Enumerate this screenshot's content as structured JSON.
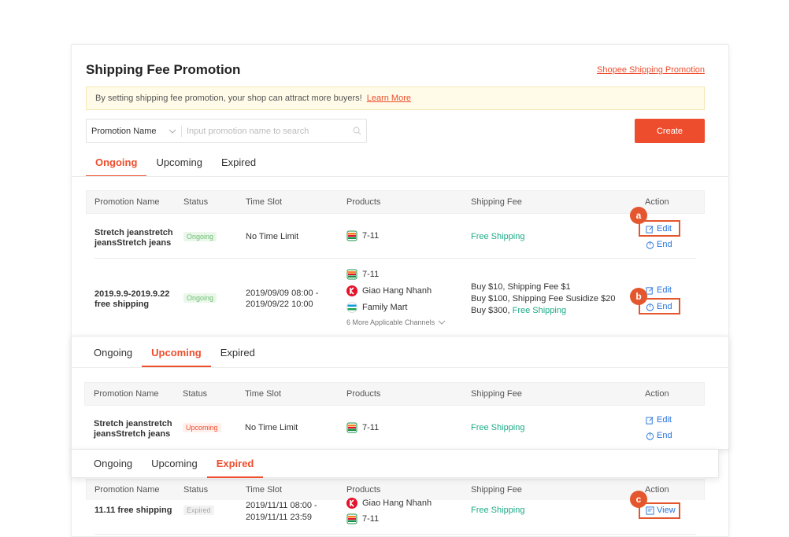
{
  "header": {
    "title": "Shipping Fee Promotion",
    "top_link": "Shopee Shipping Promotion"
  },
  "info": {
    "text": "By setting shipping fee promotion, your shop can attract more buyers!",
    "link": "Learn More"
  },
  "search": {
    "filter_label": "Promotion Name",
    "placeholder": "Input promotion name to search"
  },
  "create_button": "Create",
  "tabs": [
    "Ongoing",
    "Upcoming",
    "Expired"
  ],
  "columns": [
    "Promotion Name",
    "Status",
    "Time Slot",
    "Products",
    "Shipping Fee",
    "Action"
  ],
  "ongoing": {
    "rows": [
      {
        "name": "Stretch jeanstretch jeansStretch jeans",
        "status": "Ongoing",
        "time": "No Time Limit",
        "products": [
          "7-11"
        ],
        "fee": "Free Shipping",
        "actions": [
          "Edit",
          "End"
        ]
      },
      {
        "name": "2019.9.9-2019.9.22 free shipping",
        "status": "Ongoing",
        "time": "2019/09/09 08:00 - 2019/09/22 10:00",
        "products": [
          "7-11",
          "Giao Hang Nhanh",
          "Family Mart"
        ],
        "more": "6 More Applicable Channels",
        "fee_lines": [
          "Buy $10, Shipping Fee $1",
          "Buy $100, Shipping Fee Susidize $20",
          "Buy $300,"
        ],
        "fee_free": "Free Shipping",
        "actions": [
          "Edit",
          "End"
        ]
      }
    ]
  },
  "upcoming": {
    "rows": [
      {
        "name": "Stretch jeanstretch jeansStretch jeans",
        "status": "Upcoming",
        "time": "No Time Limit",
        "products": [
          "7-11"
        ],
        "fee": "Free Shipping",
        "actions": [
          "Edit",
          "End"
        ]
      }
    ]
  },
  "expired": {
    "rows": [
      {
        "name": "11.11 free shipping",
        "status": "Expired",
        "time": "2019/11/11 08:00 - 2019/11/11 23:59",
        "products": [
          "Giao Hang Nhanh",
          "7-11"
        ],
        "fee": "Free Shipping",
        "actions": [
          "View"
        ]
      }
    ]
  },
  "annotations": [
    "a",
    "b",
    "c"
  ],
  "colors": {
    "accent": "#ee4d2d",
    "link_blue": "#2673dd",
    "free_green": "#1dab87",
    "annotation": "#e4572e"
  }
}
